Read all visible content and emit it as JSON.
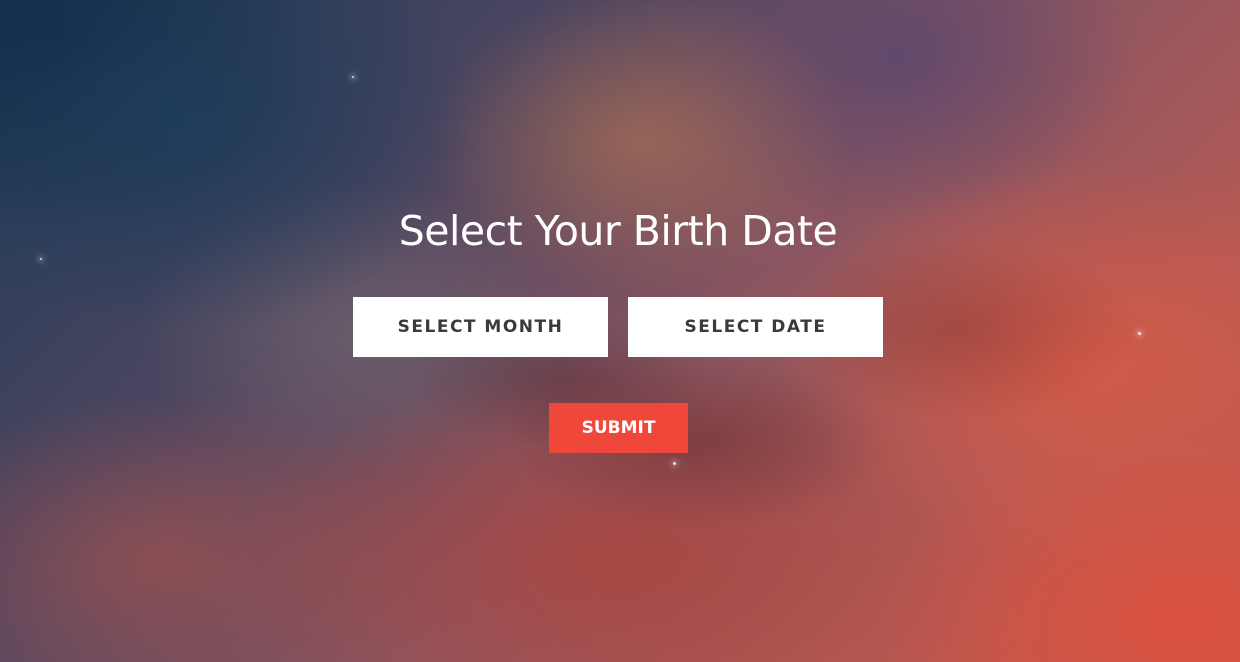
{
  "page": {
    "title": "Select Your Birth Date"
  },
  "form": {
    "month_select_label": "SELECT MONTH",
    "date_select_label": "SELECT DATE",
    "submit_label": "SUBMIT"
  },
  "colors": {
    "submit_bg": "#f0473b",
    "select_bg": "#ffffff",
    "title_color": "#ffffff"
  }
}
